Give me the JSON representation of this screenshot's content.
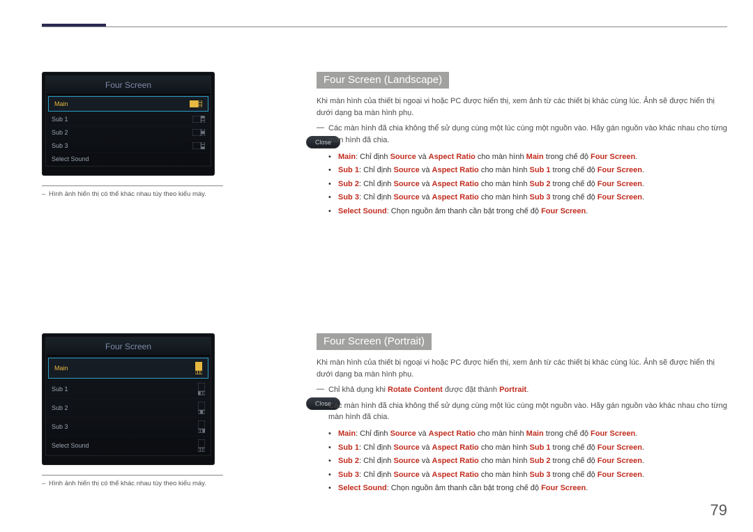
{
  "page_number": "79",
  "left": {
    "panel_title": "Four Screen",
    "close_label": "Close",
    "menu": {
      "main": "Main",
      "sub1": "Sub 1",
      "sub2": "Sub 2",
      "sub3": "Sub 3",
      "select_sound": "Select Sound"
    },
    "footnote": "Hình ảnh hiển thị có thể khác nhau tùy theo kiểu máy."
  },
  "landscape": {
    "heading": "Four Screen (Landscape)",
    "intro": "Khi màn hình của thiết bị ngoại vi hoặc PC được hiển thị, xem ảnh từ các thiết bị khác cùng lúc. Ảnh sẽ được hiển thị dưới dạng ba màn hình phụ.",
    "note1": "Các màn hình đã chia không thể sử dụng cùng một lúc cùng một nguồn vào. Hãy gán nguồn vào khác nhau cho từng màn hình đã chia.",
    "bullets": {
      "b1_a": "Main",
      "b1_b": ": Chỉ định ",
      "b1_c": "Source",
      "b1_d": " và ",
      "b1_e": "Aspect Ratio",
      "b1_f": " cho màn hình ",
      "b1_g": "Main",
      "b1_h": " trong chế độ ",
      "b1_i": "Four Screen",
      "b1_j": ".",
      "b2_a": "Sub 1",
      "b2_b": ": Chỉ định ",
      "b2_c": "Source",
      "b2_d": " và ",
      "b2_e": "Aspect Ratio",
      "b2_f": " cho màn hình ",
      "b2_g": "Sub 1",
      "b2_h": " trong chế độ ",
      "b2_i": "Four Screen",
      "b2_j": ".",
      "b3_a": "Sub 2",
      "b3_b": ": Chỉ định ",
      "b3_c": "Source",
      "b3_d": " và ",
      "b3_e": "Aspect Ratio",
      "b3_f": " cho màn hình ",
      "b3_g": "Sub 2",
      "b3_h": " trong chế độ ",
      "b3_i": "Four Screen",
      "b3_j": ".",
      "b4_a": "Sub 3",
      "b4_b": ": Chỉ định ",
      "b4_c": "Source",
      "b4_d": " và ",
      "b4_e": "Aspect Ratio",
      "b4_f": " cho màn hình ",
      "b4_g": "Sub 3",
      "b4_h": " trong chế độ ",
      "b4_i": "Four Screen",
      "b4_j": ".",
      "b5_a": "Select Sound",
      "b5_b": ": Chọn nguồn âm thanh cần bật trong chế độ ",
      "b5_c": "Four Screen",
      "b5_d": "."
    }
  },
  "portrait": {
    "heading": "Four Screen (Portrait)",
    "intro": "Khi màn hình của thiết bị ngoại vi hoặc PC được hiển thị, xem ảnh từ các thiết bị khác cùng lúc. Ảnh sẽ được hiển thị dưới dạng ba màn hình phụ.",
    "note_avail_a": "Chỉ khả dụng khi ",
    "note_avail_b": "Rotate Content",
    "note_avail_c": " được đặt thành ",
    "note_avail_d": "Portrait",
    "note_avail_e": ".",
    "note1": "Các màn hình đã chia không thể sử dụng cùng một lúc cùng một nguồn vào. Hãy gán nguồn vào khác nhau cho từng màn hình đã chia.",
    "bullets": {
      "b1_a": "Main",
      "b1_b": ": Chỉ định ",
      "b1_c": "Source",
      "b1_d": " và ",
      "b1_e": "Aspect Ratio",
      "b1_f": " cho màn hình ",
      "b1_g": "Main",
      "b1_h": " trong chế độ ",
      "b1_i": "Four Screen",
      "b1_j": ".",
      "b2_a": "Sub 1",
      "b2_b": ": Chỉ định ",
      "b2_c": "Source",
      "b2_d": " và ",
      "b2_e": "Aspect Ratio",
      "b2_f": " cho màn hình ",
      "b2_g": "Sub 1",
      "b2_h": " trong chế độ ",
      "b2_i": "Four Screen",
      "b2_j": ".",
      "b3_a": "Sub 2",
      "b3_b": ": Chỉ định ",
      "b3_c": "Source",
      "b3_d": " và ",
      "b3_e": "Aspect Ratio",
      "b3_f": " cho màn hình ",
      "b3_g": "Sub 2",
      "b3_h": " trong chế độ ",
      "b3_i": "Four Screen",
      "b3_j": ".",
      "b4_a": "Sub 3",
      "b4_b": ": Chỉ định ",
      "b4_c": "Source",
      "b4_d": " và ",
      "b4_e": "Aspect Ratio",
      "b4_f": " cho màn hình ",
      "b4_g": "Sub 3",
      "b4_h": " trong chế độ ",
      "b4_i": "Four Screen",
      "b4_j": ".",
      "b5_a": "Select Sound",
      "b5_b": ": Chọn nguồn âm thanh cần bật trong chế độ ",
      "b5_c": "Four Screen",
      "b5_d": "."
    }
  }
}
